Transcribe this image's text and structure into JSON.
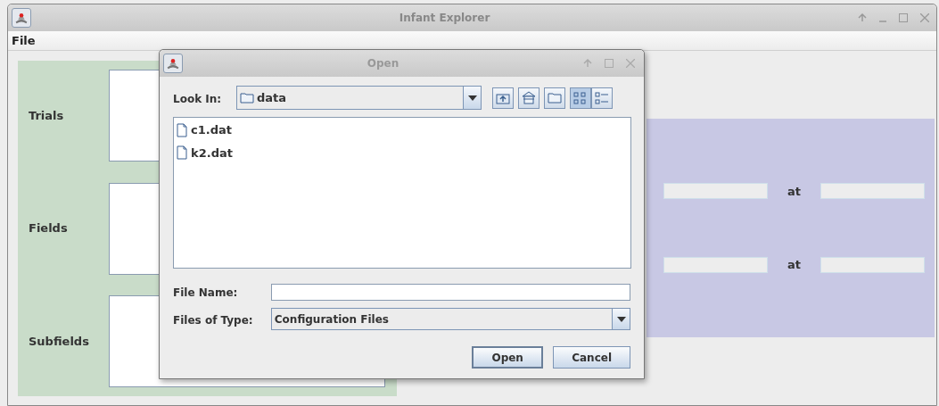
{
  "window": {
    "title": "Infant Explorer"
  },
  "menu": [
    "File"
  ],
  "left_panel": {
    "sections": [
      {
        "label": "Trials"
      },
      {
        "label": "Fields"
      },
      {
        "label": "Subfields"
      }
    ]
  },
  "right_panel": {
    "rows": [
      {
        "label": "at"
      },
      {
        "label": "at"
      }
    ]
  },
  "dialog": {
    "title": "Open",
    "look_in": {
      "label": "Look In:",
      "value": "data"
    },
    "toolbar": [
      {
        "kind": "up",
        "selected": false
      },
      {
        "kind": "home",
        "selected": false
      },
      {
        "kind": "new-folder",
        "selected": false
      },
      {
        "kind": "list",
        "selected": true
      },
      {
        "kind": "details",
        "selected": false
      }
    ],
    "files": [
      {
        "name": "c1.dat",
        "selected": false
      },
      {
        "name": "k2.dat",
        "selected": false
      }
    ],
    "file_name": {
      "label": "File Name:"
    },
    "files_of_type": {
      "label": "Files of Type:",
      "value": "Configuration Files"
    },
    "buttons": [
      {
        "label": "Open",
        "default": true
      },
      {
        "label": "Cancel",
        "default": false
      }
    ]
  }
}
